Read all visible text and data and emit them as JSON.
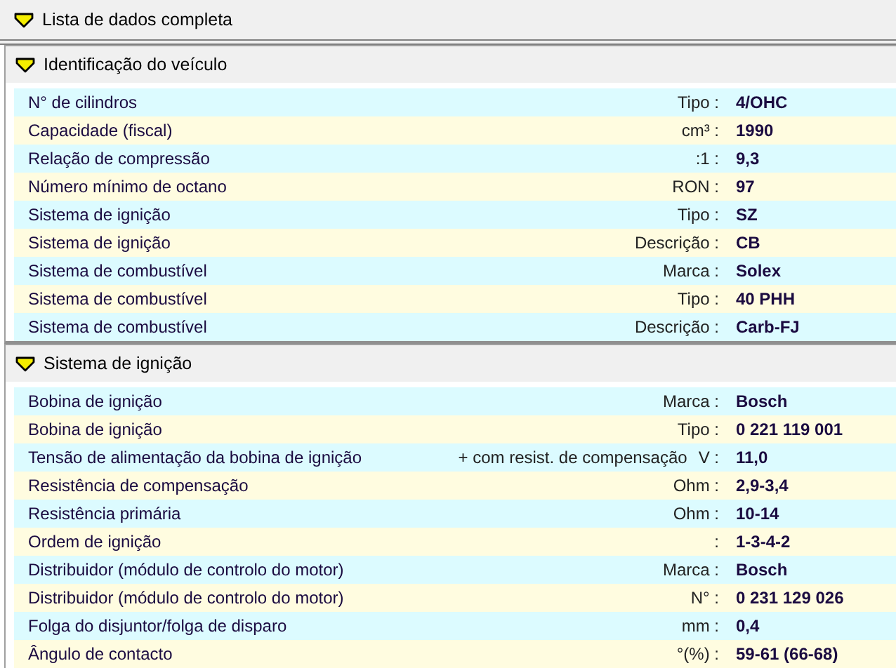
{
  "title": "Lista de dados completa",
  "sections": [
    {
      "title": "Identificação do veículo",
      "rows": [
        {
          "label": "N° de cilindros",
          "unit": "Tipo :",
          "value": "4/OHC"
        },
        {
          "label": "Capacidade (fiscal)",
          "unit": "cm³ :",
          "value": "1990"
        },
        {
          "label": "Relação de compressão",
          "unit": ":1 :",
          "value": "9,3"
        },
        {
          "label": "Número mínimo de octano",
          "unit": "RON :",
          "value": "97"
        },
        {
          "label": "Sistema de ignição",
          "unit": "Tipo :",
          "value": "SZ"
        },
        {
          "label": "Sistema de ignição",
          "unit": "Descrição :",
          "value": "CB"
        },
        {
          "label": "Sistema de combustível",
          "unit": "Marca :",
          "value": "Solex"
        },
        {
          "label": "Sistema de combustível",
          "unit": "Tipo :",
          "value": "40 PHH"
        },
        {
          "label": "Sistema de combustível",
          "unit": "Descrição :",
          "value": "Carb-FJ"
        }
      ]
    },
    {
      "title": "Sistema de ignição",
      "rows": [
        {
          "label": "Bobina de ignição",
          "unit": "Marca :",
          "value": "Bosch"
        },
        {
          "label": "Bobina de ignição",
          "unit": "Tipo :",
          "value": "0 221 119 001"
        },
        {
          "label": "Tensão de alimentação da bobina de ignição",
          "note": "+ com resist. de compensação",
          "unit": "V :",
          "value": "11,0"
        },
        {
          "label": "Resistência de compensação",
          "unit": "Ohm :",
          "value": "2,9-3,4"
        },
        {
          "label": "Resistência primária",
          "unit": "Ohm :",
          "value": "10-14"
        },
        {
          "label": "Ordem de ignição",
          "unit": ":",
          "value": "1-3-4-2"
        },
        {
          "label": "Distribuidor (módulo de controlo do motor)",
          "unit": "Marca :",
          "value": "Bosch"
        },
        {
          "label": "Distribuidor (módulo de controlo do motor)",
          "unit": "N° :",
          "value": "0 231 129 026"
        },
        {
          "label": "Folga do disjuntor/folga de disparo",
          "unit": "mm :",
          "value": "0,4"
        },
        {
          "label": "Ângulo de contacto",
          "unit": "°(%) :",
          "value": "59-61 (66-68)"
        }
      ]
    }
  ]
}
